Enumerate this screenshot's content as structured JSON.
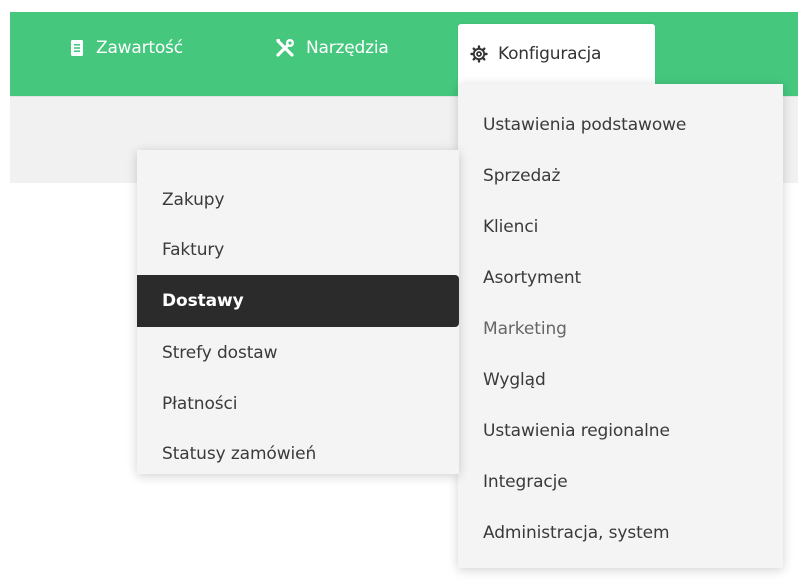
{
  "colors": {
    "brand": "#45c77e",
    "panel": "#f4f4f4",
    "highlight": "#2b2b2b"
  },
  "nav": {
    "items": [
      {
        "label": "Zawartość",
        "icon": "document-icon"
      },
      {
        "label": "Narzędzia",
        "icon": "tools-icon"
      },
      {
        "label": "Konfiguracja",
        "icon": "gear-icon",
        "active": true
      }
    ]
  },
  "config_menu": {
    "items": [
      {
        "label": "Ustawienia podstawowe"
      },
      {
        "label": "Sprzedaż"
      },
      {
        "label": "Klienci"
      },
      {
        "label": "Asortyment"
      },
      {
        "label": "Marketing"
      },
      {
        "label": "Wygląd"
      },
      {
        "label": "Ustawienia regionalne"
      },
      {
        "label": "Integracje"
      },
      {
        "label": "Administracja, system"
      }
    ]
  },
  "sales_submenu": {
    "items": [
      {
        "label": "Zakupy"
      },
      {
        "label": "Faktury"
      },
      {
        "label": "Dostawy",
        "selected": true
      },
      {
        "label": "Strefy dostaw"
      },
      {
        "label": "Płatności"
      },
      {
        "label": "Statusy zamówień"
      }
    ]
  }
}
